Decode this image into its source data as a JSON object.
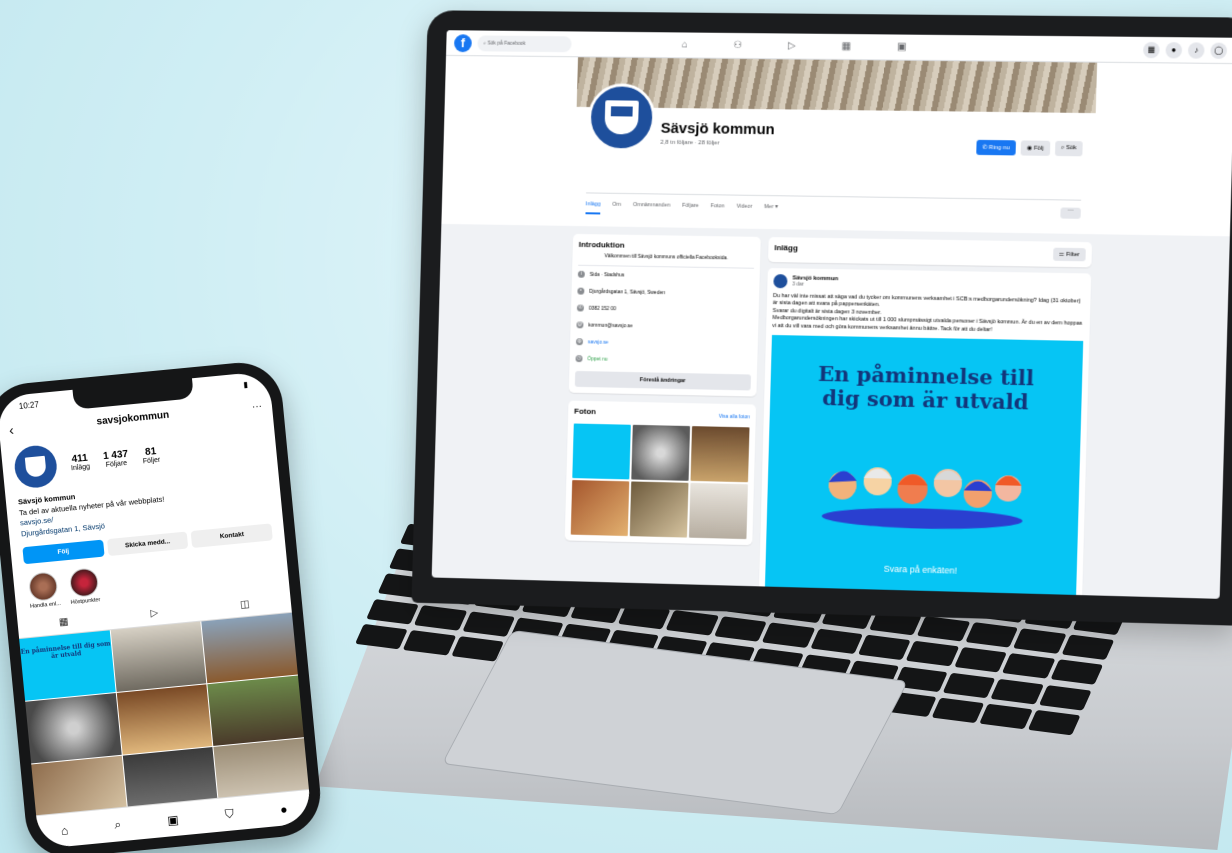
{
  "facebook": {
    "search_placeholder": "Sök på Facebook",
    "nav_icons": [
      "home-icon",
      "friends-icon",
      "watch-icon",
      "marketplace-icon",
      "groups-icon"
    ],
    "right_icons": [
      "menu-grid-icon",
      "messenger-icon",
      "bell-icon",
      "profile-icon"
    ],
    "page_name": "Sävsjö kommun",
    "page_stats": "2,8 tn följare · 28 följer",
    "actions": {
      "call": "Ring nu",
      "follow": "Följ",
      "search": "Sök"
    },
    "tabs": [
      "Inlägg",
      "Om",
      "Omnämnanden",
      "Följare",
      "Foton",
      "Videor",
      "Mer ▾"
    ],
    "more_button": "···",
    "intro": {
      "title": "Introduktion",
      "text": "Välkommen till Sävsjö kommuns officiella Facebooksida.",
      "rows": [
        {
          "icon": "info-icon",
          "text": "Sida · Stadshus",
          "type": "plain"
        },
        {
          "icon": "location-icon",
          "text": "Djurgårdsgatan 1, Sävsjö, Sweden",
          "type": "plain"
        },
        {
          "icon": "phone-icon",
          "text": "0382 152 00",
          "type": "plain"
        },
        {
          "icon": "email-icon",
          "text": "kommun@savsjo.se",
          "type": "plain"
        },
        {
          "icon": "web-icon",
          "text": "savsjo.se",
          "type": "link"
        },
        {
          "icon": "clock-icon",
          "text": "Öppet nu",
          "type": "green"
        }
      ],
      "suggest_button": "Föreslå ändringar"
    },
    "photos": {
      "title": "Foton",
      "see_all": "Visa alla foton"
    },
    "posts": {
      "title": "Inlägg",
      "filter_button": "Filter",
      "author": "Sävsjö kommun",
      "time": "3 dar",
      "text": "Du har väl inte missat att säga vad du tycker om kommunens verksamhet i SCB:s medborgarundersökning? Idag (31 oktober) är sista dagen att svara på pappersenkäten.\nSvarar du digitalt är sista dagen 3 november.\nMedborgarundersökningen har skickats ut till 1 000 slumpmässigt utvalda personer i Sävsjö kommun. Är du en av dem hoppas vi att du vill vara med och göra kommunens verksamhet ännu bättre. Tack för att du deltar!",
      "image_headline": "En påminnelse till\ndig som är utvald",
      "image_cta": "Svara på enkäten!"
    }
  },
  "instagram": {
    "time": "10:27",
    "username": "savsjokommun",
    "stats": [
      {
        "n": "411",
        "l": "Inlägg"
      },
      {
        "n": "1 437",
        "l": "Följare"
      },
      {
        "n": "81",
        "l": "Följer"
      }
    ],
    "bio_name": "Sävsjö kommun",
    "bio_text": "Ta del av aktuella nyheter på vår webbplats!",
    "bio_link": "savsjo.se/",
    "bio_address": "Djurgårdsgatan 1, Sävsjö",
    "buttons": {
      "follow": "Följ",
      "message": "Skicka medd...",
      "contact": "Kontakt"
    },
    "highlights": [
      "Handla enl...",
      "Höstpunkter"
    ],
    "grid_post_text": "En påminnelse till dig som är utvald"
  },
  "colors": {
    "fb_blue": "#1877f2",
    "ig_blue": "#0095f6",
    "brand_navy": "#1e4f9c",
    "poster_cyan": "#06c5f4"
  }
}
